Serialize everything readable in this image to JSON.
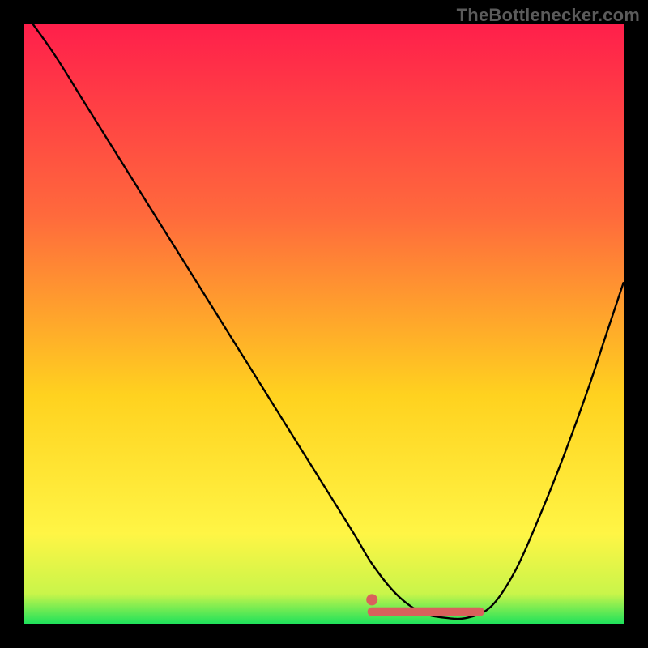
{
  "watermark": "TheBottlenecker.com",
  "colors": {
    "gradient_top": "#ff1f4b",
    "gradient_mid1": "#ff6a3c",
    "gradient_mid2": "#ffd21f",
    "gradient_mid3": "#fff545",
    "gradient_bottom": "#1fe25b",
    "curve": "#000000",
    "marker": "#d9615c",
    "frame": "#000000"
  },
  "chart_data": {
    "type": "line",
    "title": "",
    "xlabel": "",
    "ylabel": "",
    "xlim": [
      0,
      100
    ],
    "ylim": [
      0,
      100
    ],
    "series": [
      {
        "name": "curve",
        "x": [
          0,
          5,
          10,
          15,
          20,
          25,
          30,
          35,
          40,
          45,
          50,
          55,
          58,
          62,
          66,
          70,
          74,
          78,
          82,
          86,
          90,
          94,
          97,
          100
        ],
        "values": [
          102,
          95,
          87,
          79,
          71,
          63,
          55,
          47,
          39,
          31,
          23,
          15,
          10,
          5,
          2,
          1,
          1,
          3,
          9,
          18,
          28,
          39,
          48,
          57
        ]
      }
    ],
    "highlight_range": {
      "x_start": 58,
      "x_end": 76,
      "y": 2
    },
    "marker_point": {
      "x": 58,
      "y": 4
    }
  }
}
